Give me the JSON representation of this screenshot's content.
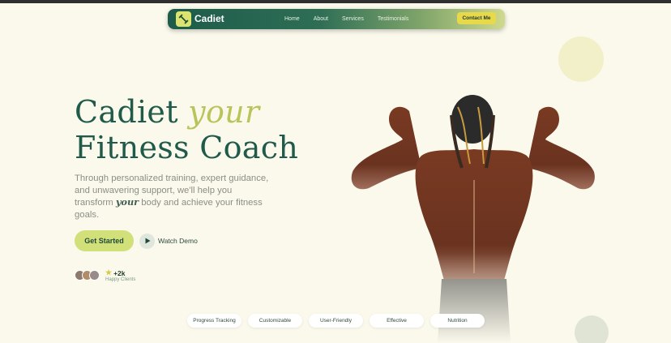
{
  "nav": {
    "brand": "Cadiet",
    "links": [
      "Home",
      "About",
      "Services",
      "Testimonials"
    ],
    "contact_label": "Contact Me"
  },
  "hero": {
    "headline_line1_a": "Cadiet",
    "headline_line1_b": "your",
    "headline_line2": "Fitness Coach",
    "desc_part1": "Through personalized training, expert guidance, and unwavering support, we'll help you transform",
    "desc_em": "your",
    "desc_part2": "body and achieve your fitness goals.",
    "cta_label": "Get Started",
    "demo_label": "Watch Demo"
  },
  "clients": {
    "count": "+2k",
    "label": "Happy Clients"
  },
  "features": [
    "Progress Tracking",
    "Customizable",
    "User-Friendly",
    "Effective",
    "Nutrition"
  ],
  "colors": {
    "background": "#fbf9ec",
    "brand_green": "#1f5a4a",
    "accent_lime": "#d2e07a",
    "contact_yellow": "#e8d94a"
  },
  "icons": {
    "logo": "dumbbell-icon",
    "play": "play-icon",
    "star": "star-icon"
  }
}
